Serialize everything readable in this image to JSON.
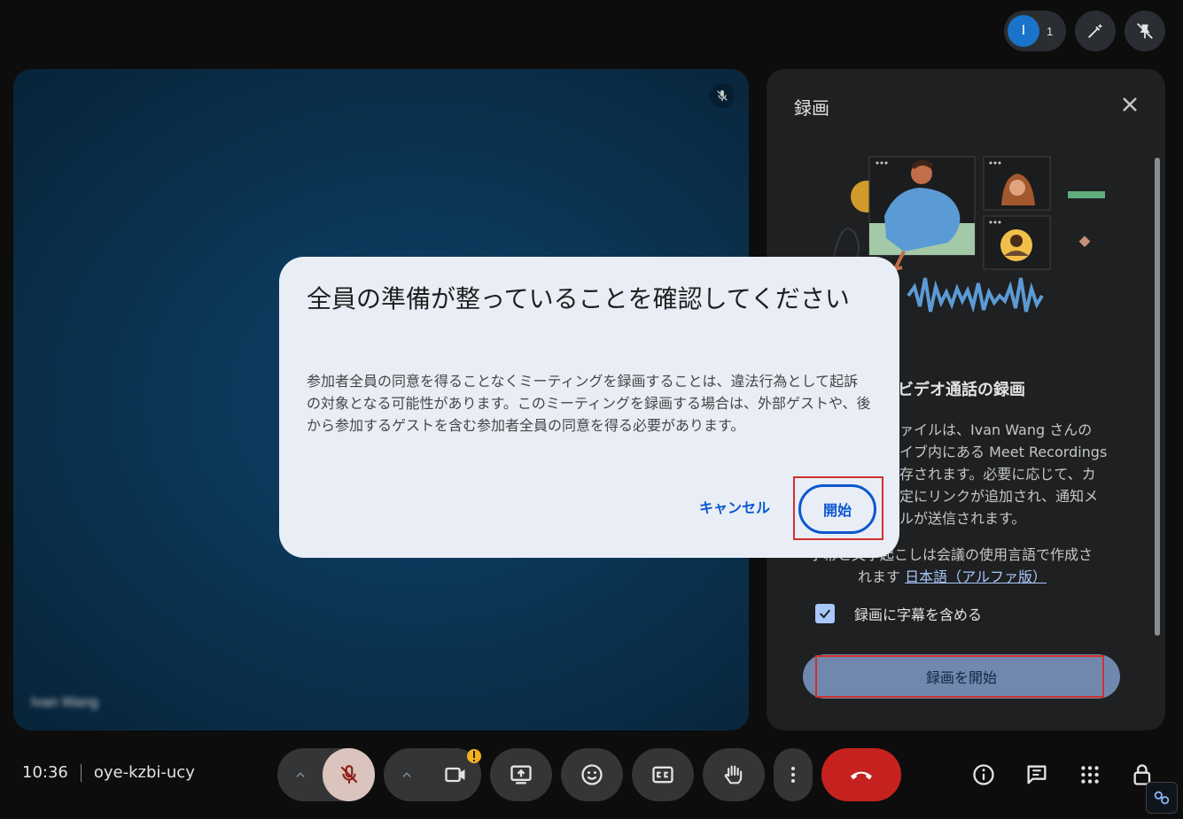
{
  "top_bar": {
    "participant_initial": "I",
    "participant_count": "1"
  },
  "video_tile": {
    "name": "Ivan Wang"
  },
  "panel": {
    "title": "録画",
    "heading": "ビデオ通話の録画",
    "desc_lines": [
      "ァイルは、Ivan Wang さんの",
      "イブ内にある Meet Recordings",
      "存されます。必要に応じて、カ",
      "定にリンクが追加され、通知メ",
      "ルが送信されます。"
    ],
    "desc2_prefix": "字幕と文字起こしは会議の使用言語で作成さ",
    "desc2_line2": "れます",
    "language_link": "日本語（アルファ版）",
    "caption_checkbox_label": "録画に字幕を含める",
    "start_recording_label": "録画を開始"
  },
  "dialog": {
    "title": "全員の準備が整っていることを確認してください",
    "body": "参加者全員の同意を得ることなくミーティングを録画することは、違法行為として起訴の対象となる可能性があります。このミーティングを録画する場合は、外部ゲストや、後から参加するゲストを含む参加者全員の同意を得る必要があります。",
    "cancel_label": "キャンセル",
    "start_label": "開始"
  },
  "meeting": {
    "time": "10:36",
    "code": "oye-kzbi-ucy"
  },
  "colors": {
    "accent": "#0b57d0",
    "end_call": "#c5221f",
    "panel_bg": "#1f2022",
    "dialog_bg": "#e9eef6"
  },
  "icons": [
    "pen-sparkle-icon",
    "pin-off-icon",
    "mic-off-icon",
    "close-icon",
    "videocam-icon",
    "present-screen-icon",
    "emoji-icon",
    "captions-icon",
    "raise-hand-icon",
    "more-vert-icon",
    "call-end-icon",
    "info-icon",
    "chat-icon",
    "apps-icon",
    "lock-person-icon",
    "link-badge-icon"
  ]
}
